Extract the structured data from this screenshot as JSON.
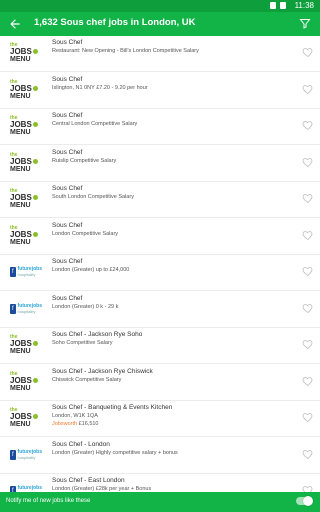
{
  "status": {
    "time": "11:38"
  },
  "appbar": {
    "title": "1,632 Sous chef jobs in London, UK"
  },
  "jobs": [
    {
      "logo": "jobsmenu",
      "title": "Sous Chef",
      "sub": "Restaurant: New Opening - Bill's London Competitive Salary",
      "sub2": ""
    },
    {
      "logo": "jobsmenu",
      "title": "Sous Chef",
      "sub": "Islington, N1 0NY £7.20 - 9.20 per hour",
      "sub2": ""
    },
    {
      "logo": "jobsmenu",
      "title": "Sous Chef",
      "sub": "Central London Competitive Salary",
      "sub2": ""
    },
    {
      "logo": "jobsmenu",
      "title": "Sous Chef",
      "sub": "Ruislip Competitive Salary",
      "sub2": ""
    },
    {
      "logo": "jobsmenu",
      "title": "Sous Chef",
      "sub": "South London Competitive Salary",
      "sub2": ""
    },
    {
      "logo": "jobsmenu",
      "title": "Sous Chef",
      "sub": "London Competitive Salary",
      "sub2": ""
    },
    {
      "logo": "futurejobs",
      "title": "Sous Chef",
      "sub": "London (Greater) up to £24,000",
      "sub2": ""
    },
    {
      "logo": "futurejobs",
      "title": "Sous Chef",
      "sub": "London (Greater) 0 k - 29 k",
      "sub2": ""
    },
    {
      "logo": "jobsmenu",
      "title": "Sous Chef - Jackson  Rye Soho",
      "sub": "Soho Competitive Salary",
      "sub2": ""
    },
    {
      "logo": "jobsmenu",
      "title": "Sous Chef - Jackson  Rye Chiswick",
      "sub": "Chiswick Competitive Salary",
      "sub2": ""
    },
    {
      "logo": "jobsmenu",
      "title": "Sous Chef - Banqueting & Events Kitchen",
      "sub": "London, W1K 1QA",
      "sub2_orange": "Jobsworth",
      "sub2": "£16,510"
    },
    {
      "logo": "futurejobs",
      "title": "Sous Chef - London",
      "sub": "London (Greater) Highly competitive salary + bonus",
      "sub2": ""
    },
    {
      "logo": "futurejobs",
      "title": "Sous Chef - East London",
      "sub": "London (Greater) £28k per year + Bonus",
      "sub2": ""
    }
  ],
  "logos": {
    "jobsmenu": {
      "the": "the",
      "jobs": "JOBS",
      "menu": "MENU",
      "com": ".com"
    },
    "futurejobs": {
      "mark": "fj",
      "word": "futurejobs",
      "tag": "hospitality"
    }
  },
  "bottombar": {
    "label": "Notify me of new jobs like these",
    "toggle_on": true
  },
  "colors": {
    "primary": "#12b347",
    "status": "#0f9e3c",
    "accent_orange": "#f07b2d"
  }
}
